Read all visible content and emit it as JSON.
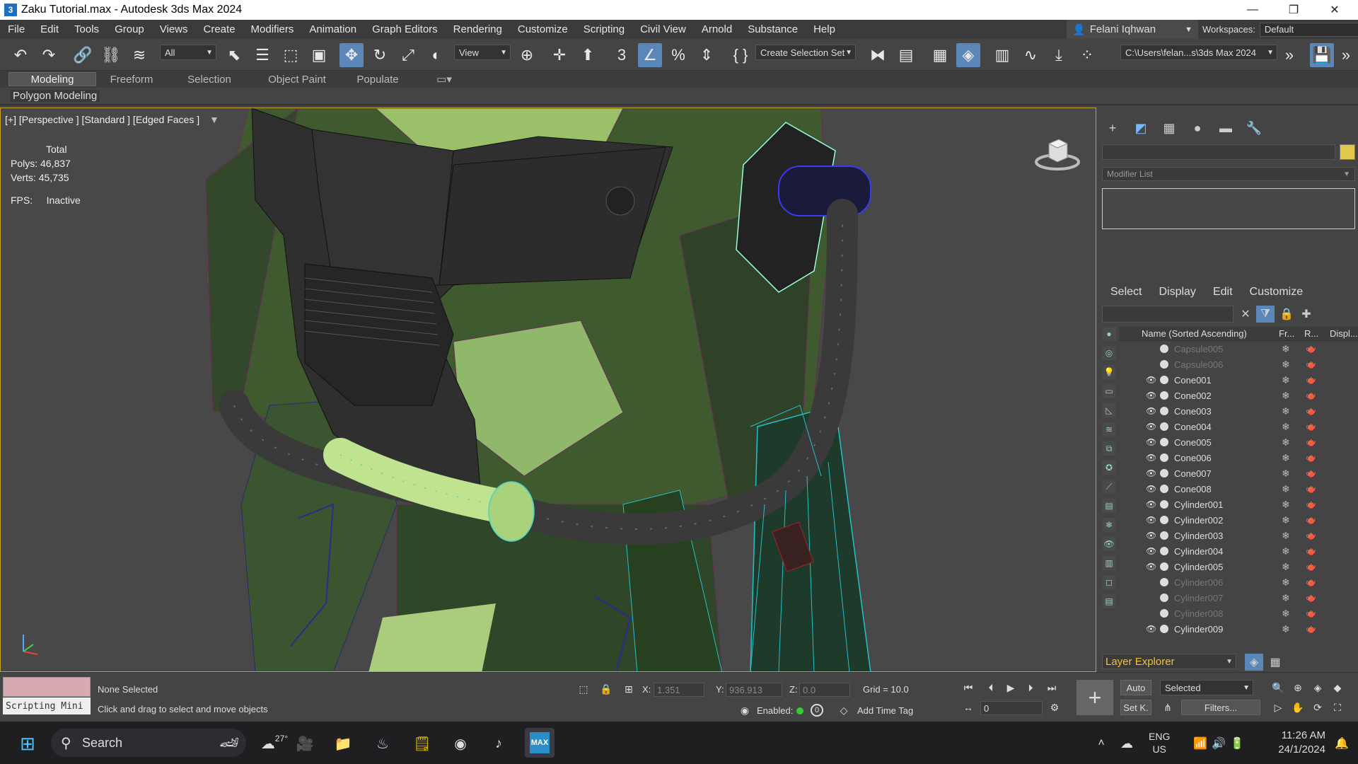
{
  "window": {
    "title": "Zaku Tutorial.max - Autodesk 3ds Max 2024",
    "app_icon": "3"
  },
  "menu": [
    "File",
    "Edit",
    "Tools",
    "Group",
    "Views",
    "Create",
    "Modifiers",
    "Animation",
    "Graph Editors",
    "Rendering",
    "Customize",
    "Scripting",
    "Civil View",
    "Arnold",
    "Substance",
    "Help"
  ],
  "user": "Felani Iqhwan",
  "workspace": {
    "label": "Workspaces:",
    "value": "Default"
  },
  "toolbar": {
    "filter": "All",
    "ref_coord": "View",
    "selection_set": "Create Selection Set",
    "project_path": "C:\\Users\\felan...s\\3ds Max 2024"
  },
  "ribbon": {
    "tabs": [
      "Modeling",
      "Freeform",
      "Selection",
      "Object Paint",
      "Populate"
    ],
    "active": "Modeling",
    "sub": "Polygon Modeling"
  },
  "viewport": {
    "label": "[+] [Perspective ] [Standard ] [Edged Faces ]",
    "stats_header": "Total",
    "polys_label": "Polys:",
    "polys": "46,837",
    "verts_label": "Verts:",
    "verts": "45,735",
    "fps_label": "FPS:",
    "fps": "Inactive"
  },
  "command_panel": {
    "modifier_list": "Modifier List",
    "swatch_color": "#e2c84a"
  },
  "scene_explorer": {
    "tabs": [
      "Select",
      "Display",
      "Edit",
      "Customize"
    ],
    "columns": [
      "Name (Sorted Ascending)",
      "Fr...",
      "R...",
      "Displ..."
    ],
    "rows": [
      {
        "name": "Capsule005",
        "visible": false
      },
      {
        "name": "Capsule006",
        "visible": false
      },
      {
        "name": "Cone001",
        "visible": true
      },
      {
        "name": "Cone002",
        "visible": true
      },
      {
        "name": "Cone003",
        "visible": true
      },
      {
        "name": "Cone004",
        "visible": true
      },
      {
        "name": "Cone005",
        "visible": true
      },
      {
        "name": "Cone006",
        "visible": true
      },
      {
        "name": "Cone007",
        "visible": true
      },
      {
        "name": "Cone008",
        "visible": true
      },
      {
        "name": "Cylinder001",
        "visible": true
      },
      {
        "name": "Cylinder002",
        "visible": true
      },
      {
        "name": "Cylinder003",
        "visible": true
      },
      {
        "name": "Cylinder004",
        "visible": true
      },
      {
        "name": "Cylinder005",
        "visible": true
      },
      {
        "name": "Cylinder006",
        "visible": false
      },
      {
        "name": "Cylinder007",
        "visible": false
      },
      {
        "name": "Cylinder008",
        "visible": false
      },
      {
        "name": "Cylinder009",
        "visible": true
      }
    ],
    "layer_explorer": "Layer Explorer"
  },
  "status": {
    "script_mini": "Scripting Mini",
    "selection": "None Selected",
    "prompt": "Click and drag to select and move objects",
    "x_label": "X:",
    "x": "1.351",
    "y_label": "Y:",
    "y": "936.913",
    "z_label": "Z:",
    "z": "0.0",
    "grid": "Grid = 10.0",
    "enabled": "Enabled:",
    "enabled_count": "0",
    "time_tag": "Add Time Tag",
    "frame": "0",
    "auto": "Auto",
    "setk": "Set K.",
    "key_filter": "Selected",
    "filters": "Filters..."
  },
  "taskbar": {
    "search": "Search",
    "weather": "27°",
    "app_label": "MAX",
    "lang": "ENG",
    "region": "US",
    "time": "11:26 AM",
    "date": "24/1/2024"
  }
}
